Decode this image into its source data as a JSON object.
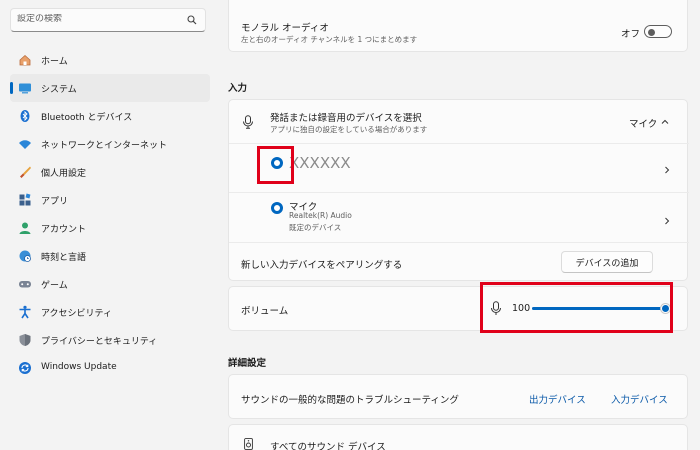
{
  "search": {
    "placeholder": "設定の検索"
  },
  "nav": [
    {
      "label": "ホーム",
      "icon": "home-icon"
    },
    {
      "label": "システム",
      "icon": "system-icon",
      "active": true
    },
    {
      "label": "Bluetooth とデバイス",
      "icon": "bluetooth-icon"
    },
    {
      "label": "ネットワークとインターネット",
      "icon": "wifi-icon"
    },
    {
      "label": "個人用設定",
      "icon": "brush-icon"
    },
    {
      "label": "アプリ",
      "icon": "apps-icon"
    },
    {
      "label": "アカウント",
      "icon": "account-icon"
    },
    {
      "label": "時刻と言語",
      "icon": "clock-globe-icon"
    },
    {
      "label": "ゲーム",
      "icon": "gamepad-icon"
    },
    {
      "label": "アクセシビリティ",
      "icon": "accessibility-icon"
    },
    {
      "label": "プライバシーとセキュリティ",
      "icon": "shield-icon"
    },
    {
      "label": "Windows Update",
      "icon": "update-icon"
    }
  ],
  "mono": {
    "title": "モノラル オーディオ",
    "desc": "左と右のオーディオ チャンネルを 1 つにまとめます",
    "state": "オフ"
  },
  "input_section": "入力",
  "choose": {
    "title": "発話または録音用のデバイスを選択",
    "desc": "アプリに独自の設定をしている場合があります",
    "selected": "マイク"
  },
  "device1": {
    "name": "XXXXXX"
  },
  "device2": {
    "name": "マイク",
    "driver": "Realtek(R) Audio",
    "note": "既定のデバイス"
  },
  "pair": {
    "title": "新しい入力デバイスをペアリングする",
    "button": "デバイスの追加"
  },
  "volume": {
    "title": "ボリューム",
    "value": "100",
    "level": 1.0
  },
  "advanced_section": "詳細設定",
  "troubleshoot": {
    "title": "サウンドの一般的な問題のトラブルシューティング",
    "out": "出力デバイス",
    "in": "入力デバイス"
  },
  "all_devices": {
    "title": "すべてのサウンド デバイス"
  },
  "colors": {
    "accent": "#0067c0",
    "highlight": "#e0001a"
  }
}
